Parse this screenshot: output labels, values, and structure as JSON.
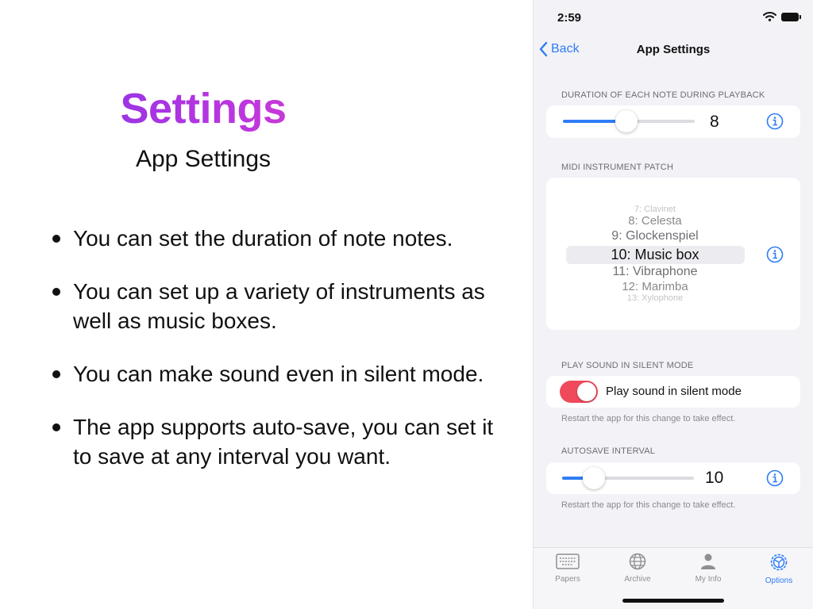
{
  "promo": {
    "title": "Settings",
    "subtitle": "App Settings",
    "bullets": [
      "You can set the duration of note notes.",
      "You can set up a variety of instruments as well as music boxes.",
      "You can make sound even in silent mode.",
      "The app supports auto-save, you can set it to save at any interval you want."
    ]
  },
  "status": {
    "time": "2:59"
  },
  "nav": {
    "back_label": "Back",
    "title": "App Settings"
  },
  "duration": {
    "label": "DURATION OF EACH NOTE DURING PLAYBACK",
    "value": "8",
    "slider_fraction": 0.48
  },
  "instrument": {
    "label": "MIDI INSTRUMENT PATCH",
    "options": [
      "7: Clavinet",
      "8: Celesta",
      "9: Glockenspiel",
      "10: Music box",
      "11: Vibraphone",
      "12: Marimba",
      "13: Xylophone"
    ],
    "selected": "10: Music box"
  },
  "silent": {
    "label": "PLAY SOUND IN SILENT MODE",
    "toggle_label": "Play sound in silent mode",
    "enabled": true,
    "footer": "Restart the app for this change to take effect."
  },
  "autosave": {
    "label": "AUTOSAVE INTERVAL",
    "value": "10",
    "slider_fraction": 0.24,
    "footer": "Restart the app for this change to take effect."
  },
  "tabs": [
    {
      "label": "Papers",
      "icon": "keyboard-icon"
    },
    {
      "label": "Archive",
      "icon": "globe-icon"
    },
    {
      "label": "My Info",
      "icon": "person-icon"
    },
    {
      "label": "Options",
      "icon": "gear-icon",
      "active": true
    }
  ],
  "colors": {
    "accent": "#2f7cf6",
    "toggle_on": "#ef4a5b",
    "title_gradient_start": "#7a35e8",
    "title_gradient_end": "#e23fc8"
  }
}
